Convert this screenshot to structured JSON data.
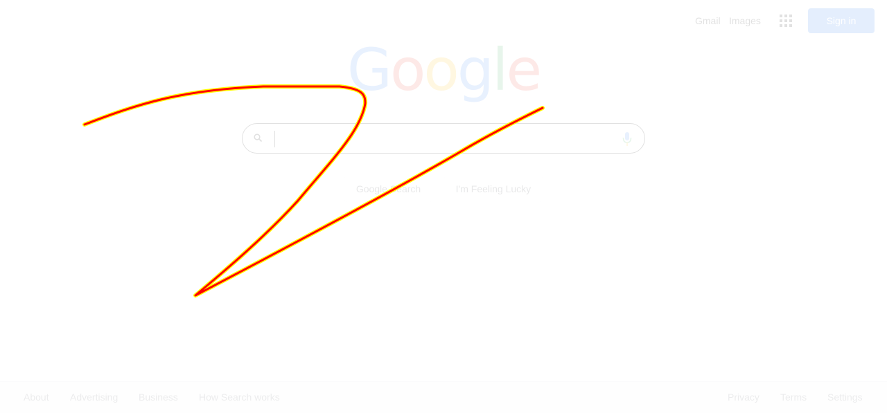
{
  "header": {
    "gmail_label": "Gmail",
    "images_label": "Images",
    "apps_icon": "apps-grid-icon",
    "sign_in_label": "Sign in"
  },
  "logo": {
    "letters": [
      "G",
      "o",
      "o",
      "g",
      "l",
      "e"
    ],
    "colors": [
      "#4285f4",
      "#ea4335",
      "#fbbc05",
      "#4285f4",
      "#34a853",
      "#ea4335"
    ]
  },
  "search": {
    "value": "",
    "search_icon": "search-icon",
    "mic_icon": "microphone-icon"
  },
  "buttons": {
    "search_label": "Google Search",
    "lucky_label": "I'm Feeling Lucky"
  },
  "footer": {
    "left_links": [
      "About",
      "Advertising",
      "Business",
      "How Search works"
    ],
    "right_links": [
      "Privacy",
      "Terms",
      "Settings"
    ]
  },
  "annotation": {
    "stroke_color": "#ff0000",
    "halo_color": "#ffff00"
  }
}
